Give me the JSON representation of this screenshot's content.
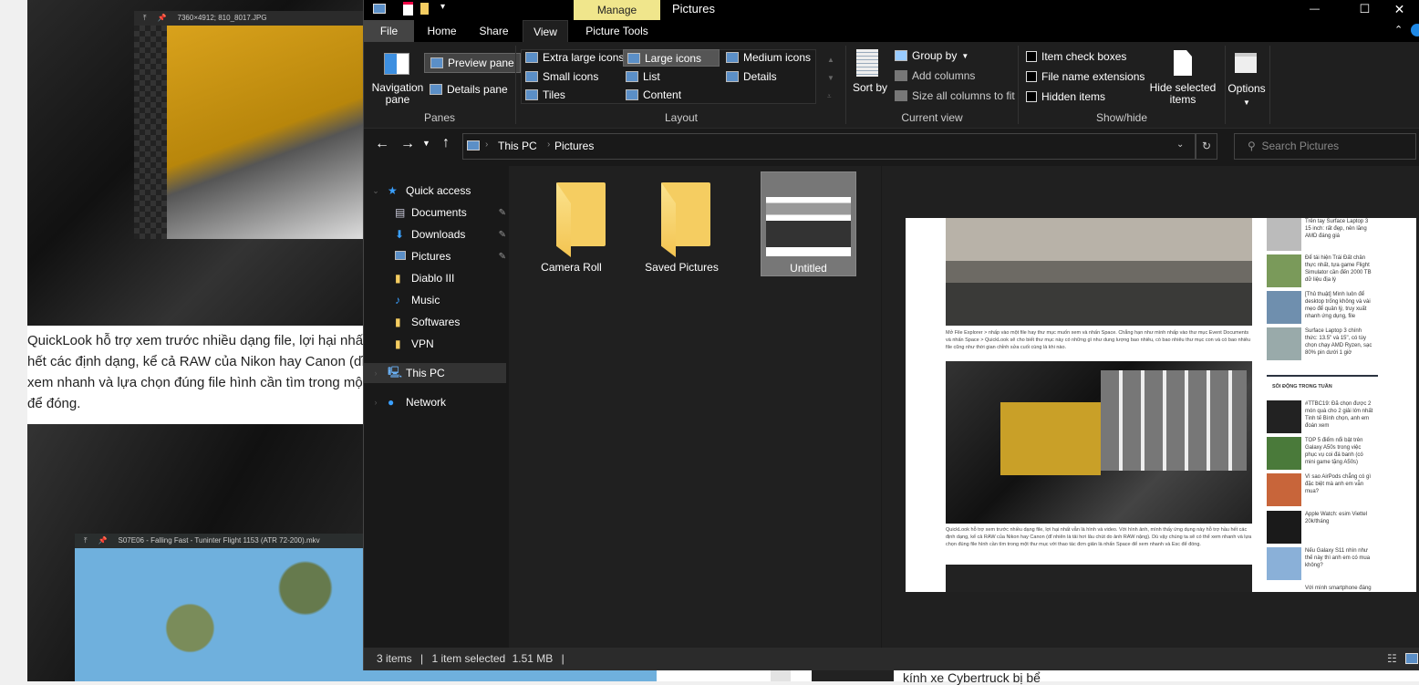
{
  "background": {
    "quicklook_top_title": "7360×4912; 810_8017.JPG",
    "article_lines": [
      "QuickLook hỗ trợ xem trước nhiều dạng file, lợi hại nhất v",
      "hết các định dạng, kể cả RAW của Nikon hay Canon (dĩ n",
      "xem nhanh và lựa chọn đúng file hình cần tìm trong một t",
      "để đóng."
    ],
    "quicklook_bottom_title": "S07E06 - Falling Fast - Tuninter Flight 1153 (ATR 72-200).mkv",
    "bottom_headline": "kính xe Cybertruck bị bể"
  },
  "window": {
    "title": "Pictures",
    "context_tab": "Manage",
    "controls": {
      "minimize": "—",
      "maximize": "☐",
      "close": "✕"
    },
    "tabs": [
      {
        "label": "File",
        "active": false
      },
      {
        "label": "Home",
        "active": false
      },
      {
        "label": "Share",
        "active": false
      },
      {
        "label": "View",
        "active": true
      },
      {
        "label": "Picture Tools",
        "active": false
      }
    ],
    "ribbon": {
      "panes": {
        "label": "Panes",
        "navigation_pane": "Navigation pane",
        "preview_pane": "Preview pane",
        "details_pane": "Details pane"
      },
      "layout": {
        "label": "Layout",
        "options": [
          "Extra large icons",
          "Large icons",
          "Medium icons",
          "Small icons",
          "List",
          "Details",
          "Tiles",
          "Content"
        ],
        "selected": "Large icons"
      },
      "current_view": {
        "label": "Current view",
        "sort_by": "Sort by",
        "group_by": "Group by",
        "add_columns": "Add columns",
        "size_columns": "Size all columns to fit"
      },
      "show_hide": {
        "label": "Show/hide",
        "item_check_boxes": "Item check boxes",
        "file_name_extensions": "File name extensions",
        "hidden_items": "Hidden items",
        "hide_selected": "Hide selected items"
      },
      "options": {
        "label": "Options"
      }
    },
    "address": {
      "breadcrumb": [
        "This PC",
        "Pictures"
      ],
      "search_placeholder": "Search Pictures"
    },
    "nav": {
      "quick_access": "Quick access",
      "items": [
        {
          "label": "Documents",
          "icon": "document-icon",
          "pinned": true
        },
        {
          "label": "Downloads",
          "icon": "download-icon",
          "pinned": true
        },
        {
          "label": "Pictures",
          "icon": "pictures-icon",
          "pinned": true
        },
        {
          "label": "Diablo III",
          "icon": "folder-icon",
          "pinned": false
        },
        {
          "label": "Music",
          "icon": "music-icon",
          "pinned": false
        },
        {
          "label": "Softwares",
          "icon": "folder-icon",
          "pinned": false
        },
        {
          "label": "VPN",
          "icon": "folder-icon",
          "pinned": false
        }
      ],
      "this_pc": "This PC",
      "network": "Network"
    },
    "files": [
      {
        "name": "Camera Roll",
        "type": "folder",
        "selected": false
      },
      {
        "name": "Saved Pictures",
        "type": "folder",
        "selected": false
      },
      {
        "name": "Untitled",
        "type": "image",
        "selected": true
      }
    ],
    "preview": {
      "caption": "Mở File Explorer > nhấp vào một file hay thư mục muốn xem và nhấn Space. Chẳng hạn như mình nhấp vào thư mục Event Documents và nhấn Space > QuickLook sẽ cho biết thư mục này có những gì như dung lượng bao nhiêu, có bao nhiêu thư mục con và có bao nhiêu file cũng như thời gian chỉnh sửa cuối cùng là khi nào.",
      "section_title": "SÔI ĐỘNG TRONG TUẦN",
      "sidebar_top": [
        "Trên tay Surface Laptop 3 15 inch: rất đẹp, nên lăng AMD đáng giá",
        "Để tái hiện Trái Đất chân thực nhất, tựa game Flight Simulator cần đến 2000 TB dữ liệu địa lý",
        "[Thủ thuật] Mình luôn để desktop trống không và vài mẹo để quản lý, truy xuất nhanh ứng dụng, file",
        "Surface Laptop 3 chính thức: 13.5\" và 15\", có tùy chọn chạy AMD Ryzen, sạc 80% pin dưới 1 giờ"
      ],
      "sidebar_bottom": [
        "#TTBC19: Đã chọn được 2 món quà cho 2 giải lớn nhất Tinh tế Bình chọn, anh em đoán xem",
        "TOP 5 điểm nổi bật trên Galaxy A50s trong việc phục vụ coi đá banh (có mini game tặng A50s)",
        "Vì sao AirPods chẳng có gì đặc biệt mà anh em vẫn mua?",
        "Apple Watch: esim Viettel 20k/tháng",
        "Nếu Galaxy S11 nhìn như thế này thì anh em có mua không?",
        "Với mình smartphone đáng"
      ],
      "quicklook_body": "QuickLook hỗ trợ xem trước nhiều dạng file, lợi hại nhất vẫn là hình và video. Với hình ảnh, mình thấy ứng dụng này hỗ trợ hầu hết các định dạng, kể cả RAW của Nikon hay Canon (dĩ nhiên là tải hơi lâu chút do ảnh RAW nặng). Dù vậy chúng ta sẽ có thể xem nhanh và lựa chọn đúng file hình cần tìm trong một thư mục với thao tác đơn giản là nhấn Space để xem nhanh và Esc để đóng."
    },
    "status": {
      "items": "3 items",
      "selected": "1 item selected",
      "size": "1.51 MB"
    }
  }
}
